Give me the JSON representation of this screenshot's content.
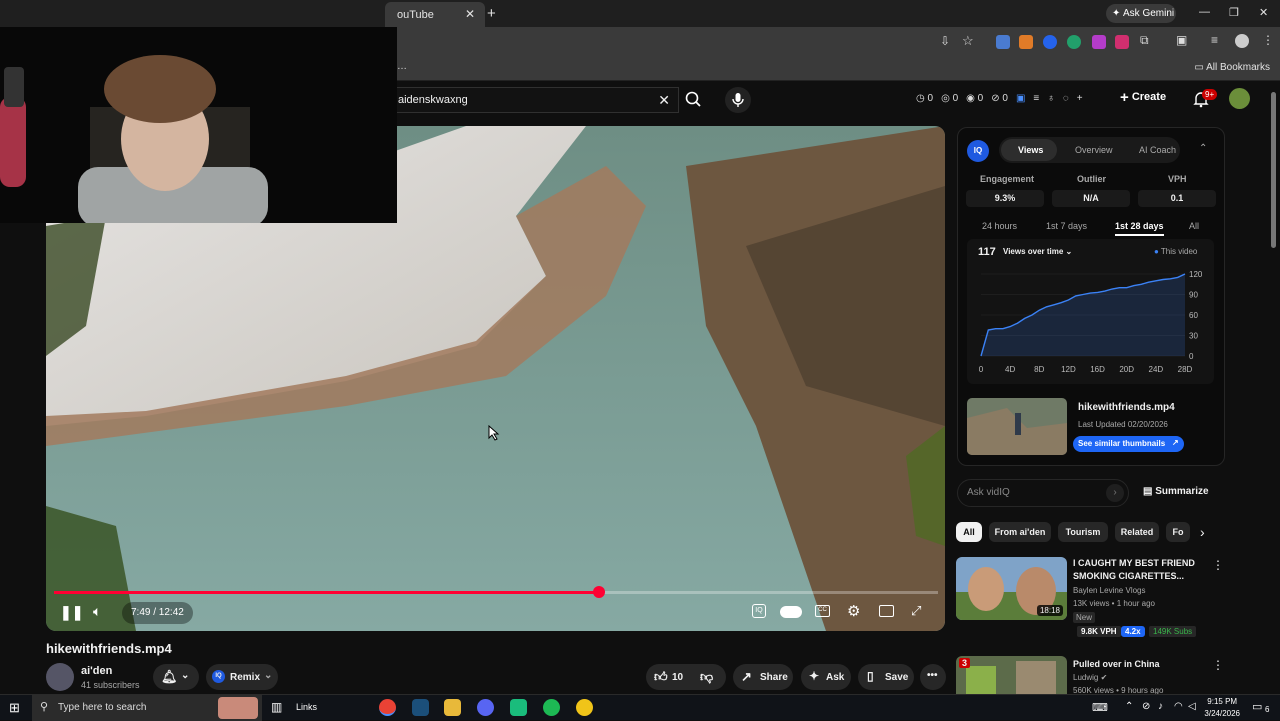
{
  "browser": {
    "tab_title": "ouTube",
    "ask_gemini": "Ask Gemini",
    "all_bookmarks": "All Bookmarks"
  },
  "youtube": {
    "search_query": "aidenskwaxng",
    "stats": [
      "0",
      "0",
      "0",
      "0"
    ],
    "create_label": "Create",
    "notifications_badge": "9+"
  },
  "player": {
    "time_display": "7:49 / 12:42",
    "progress_fraction": 0.616
  },
  "video": {
    "title": "hikewithfriends.mp4",
    "channel_name": "ai'den",
    "subscribers": "41 subscribers",
    "remix_label": "Remix",
    "like_count": "10",
    "share_label": "Share",
    "ask_label": "Ask",
    "save_label": "Save"
  },
  "vidiq": {
    "tabs": [
      "Views",
      "Overview",
      "AI Coach"
    ],
    "metrics": [
      {
        "label": "Engagement",
        "value": "9.3%"
      },
      {
        "label": "Outlier",
        "value": "N/A"
      },
      {
        "label": "VPH",
        "value": "0.1"
      }
    ],
    "ranges": [
      "24 hours",
      "1st 7 days",
      "1st 28 days",
      "All"
    ],
    "total_views": "117",
    "views_dropdown": "Views over time",
    "legend": "This video",
    "file_name": "hikewithfriends.mp4",
    "last_updated": "Last Updated 02/20/2026",
    "similar_btn": "See similar thumbnails",
    "ask_placeholder": "Ask vidIQ",
    "summarize": "Summarize"
  },
  "chart_data": {
    "type": "area",
    "x_ticks": [
      "0",
      "4D",
      "8D",
      "12D",
      "16D",
      "20D",
      "24D",
      "28D"
    ],
    "y_ticks": [
      "120",
      "90",
      "60",
      "30",
      "0"
    ],
    "ylim": [
      0,
      120
    ],
    "xlim": [
      0,
      28
    ],
    "series": [
      {
        "name": "This video",
        "x": [
          0,
          1,
          2,
          3,
          4,
          5,
          6,
          7,
          8,
          9,
          10,
          11,
          12,
          13,
          14,
          15,
          16,
          17,
          18,
          19,
          20,
          21,
          22,
          23,
          24,
          25,
          26,
          27,
          28
        ],
        "y": [
          0,
          38,
          40,
          40,
          43,
          48,
          55,
          60,
          67,
          72,
          75,
          78,
          82,
          88,
          90,
          92,
          93,
          95,
          98,
          100,
          100,
          103,
          105,
          108,
          110,
          112,
          113,
          115,
          120
        ]
      }
    ],
    "color": "#3b82f6",
    "grid": true
  },
  "chips": [
    "All",
    "From ai'den",
    "Tourism",
    "Related",
    "Fo"
  ],
  "recommendations": [
    {
      "title": "I CAUGHT MY BEST FRIEND SMOKING CIGARETTES...",
      "channel": "Baylen Levine Vlogs",
      "meta": "13K views • 1 hour ago",
      "badge": "New",
      "duration": "18:18",
      "vph": "9.8K VPH",
      "ratio": "4.2x",
      "subs": "149K Subs"
    },
    {
      "title": "Pulled over in China",
      "channel": "Ludwig",
      "meta": "560K views • 9 hours ago",
      "rank": "3"
    }
  ],
  "taskbar": {
    "search_placeholder": "Type here to search",
    "links": "Links",
    "time": "9:15 PM",
    "date": "3/24/2026",
    "notif_count": "6"
  }
}
